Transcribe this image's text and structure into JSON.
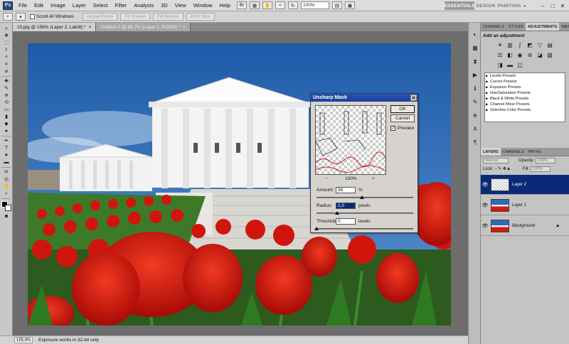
{
  "menubar": {
    "logo": "Ps",
    "items": [
      "File",
      "Edit",
      "Image",
      "Layer",
      "Select",
      "Filter",
      "Analysis",
      "3D",
      "View",
      "Window",
      "Help"
    ],
    "zoom": "100%",
    "workspaces": [
      "ESSENTIALS",
      "DESIGN",
      "PAINTING",
      "»"
    ]
  },
  "options": {
    "scroll_all": "Scroll All Windows",
    "buttons": [
      "Actual Pixels",
      "Fit Screen",
      "Fill Screen",
      "Print Size"
    ]
  },
  "tabs": [
    {
      "label": "15.jpg @ 156% (Layer 2, Lab/8) *",
      "close": "×"
    },
    {
      "label": "Untitled-2 @ 66,7% (Layer 1, RGB/8) *",
      "close": "×"
    }
  ],
  "status": {
    "zoom": "155,9%",
    "info": "Exposure works in 32-bit only"
  },
  "dialog": {
    "title": "Unsharp Mask",
    "ok": "OK",
    "cancel": "Cancel",
    "preview": "Preview",
    "zoom_minus": "−",
    "zoom_value": "100%",
    "zoom_plus": "+",
    "amount_label": "Amount:",
    "amount_value": "98",
    "amount_unit": "%",
    "amount_level": 0.49,
    "radius_label": "Radius:",
    "radius_value": "1,0",
    "radius_unit": "pixels",
    "radius_level": 0.22,
    "threshold_label": "Threshold:",
    "threshold_value": "0",
    "threshold_unit": "levels",
    "threshold_level": 0.0
  },
  "panels": {
    "top_tabs": [
      "CHANNELS",
      "STYLES",
      "ADJUSTMENTS",
      "MASKS"
    ],
    "adj_title": "Add an adjustment",
    "presets": [
      "Levels Presets",
      "Curves Presets",
      "Exposure Presets",
      "Hue/Saturation Presets",
      "Black & White Presets",
      "Channel Mixer Presets",
      "Selective Color Presets"
    ],
    "layer_tabs": [
      "LAYERS",
      "CHANNELS",
      "PATHS"
    ],
    "blend_mode": "Normal",
    "opacity_label": "Opacity:",
    "opacity_value": "100%",
    "lock_label": "Lock:",
    "fill_label": "Fill:",
    "fill_value": "100%",
    "layers": [
      "Layer 2",
      "Layer 1",
      "Background"
    ]
  },
  "colors": {
    "selected_layer": "#0a2a78",
    "title_bar": "#2a55b8",
    "sky": "#2f6bb8",
    "tulip": "#d41a10"
  }
}
